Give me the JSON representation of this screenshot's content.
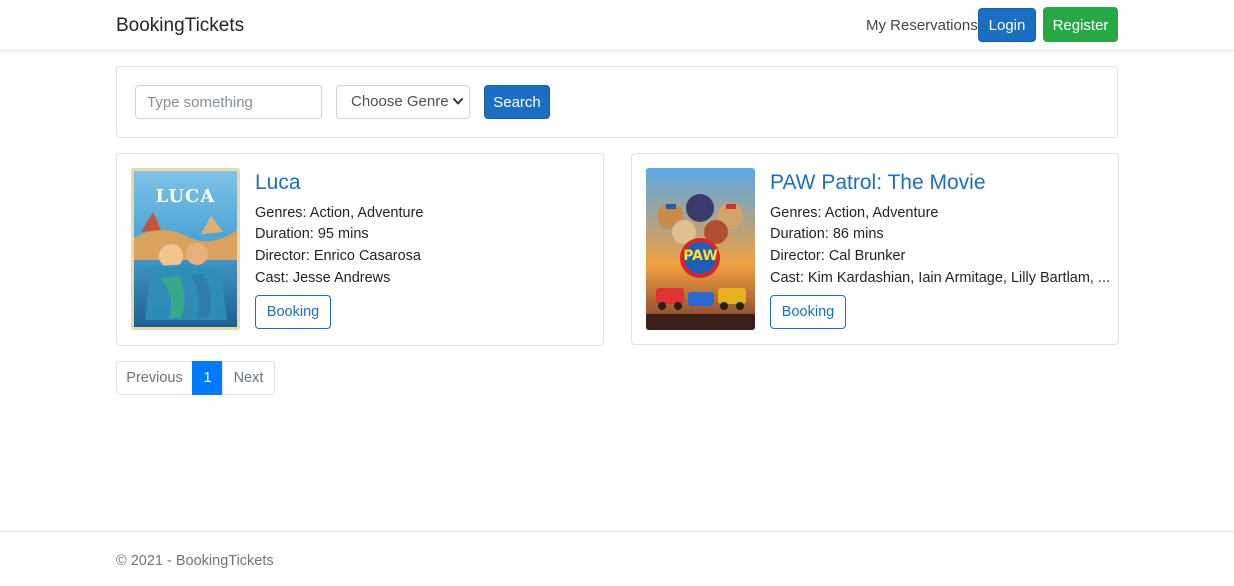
{
  "navbar": {
    "brand": "BookingTickets",
    "my_reservations": "My Reservations",
    "login_label": "Login",
    "register_label": "Register"
  },
  "search": {
    "placeholder": "Type something",
    "genre_selected": "Choose Genre",
    "button_label": "Search"
  },
  "movies": [
    {
      "title": "Luca",
      "genres": "Genres: Action, Adventure",
      "duration": "Duration: 95 mins",
      "director": "Director: Enrico Casarosa",
      "cast": "Cast: Jesse Andrews",
      "booking_label": "Booking",
      "poster_text": "LUCA"
    },
    {
      "title": "PAW Patrol: The Movie",
      "genres": "Genres: Action, Adventure",
      "duration": "Duration: 86 mins",
      "director": "Director: Cal Brunker",
      "cast": "Cast: Kim Kardashian, Iain Armitage, Lilly Bartlam, ...",
      "booking_label": "Booking",
      "poster_text": "PAW"
    }
  ],
  "pagination": {
    "previous": "Previous",
    "current": "1",
    "next": "Next"
  },
  "footer": {
    "text": "© 2021 - BookingTickets"
  },
  "colors": {
    "primary": "#1b6ec2",
    "success": "#28a745",
    "active_page": "#007bff"
  }
}
